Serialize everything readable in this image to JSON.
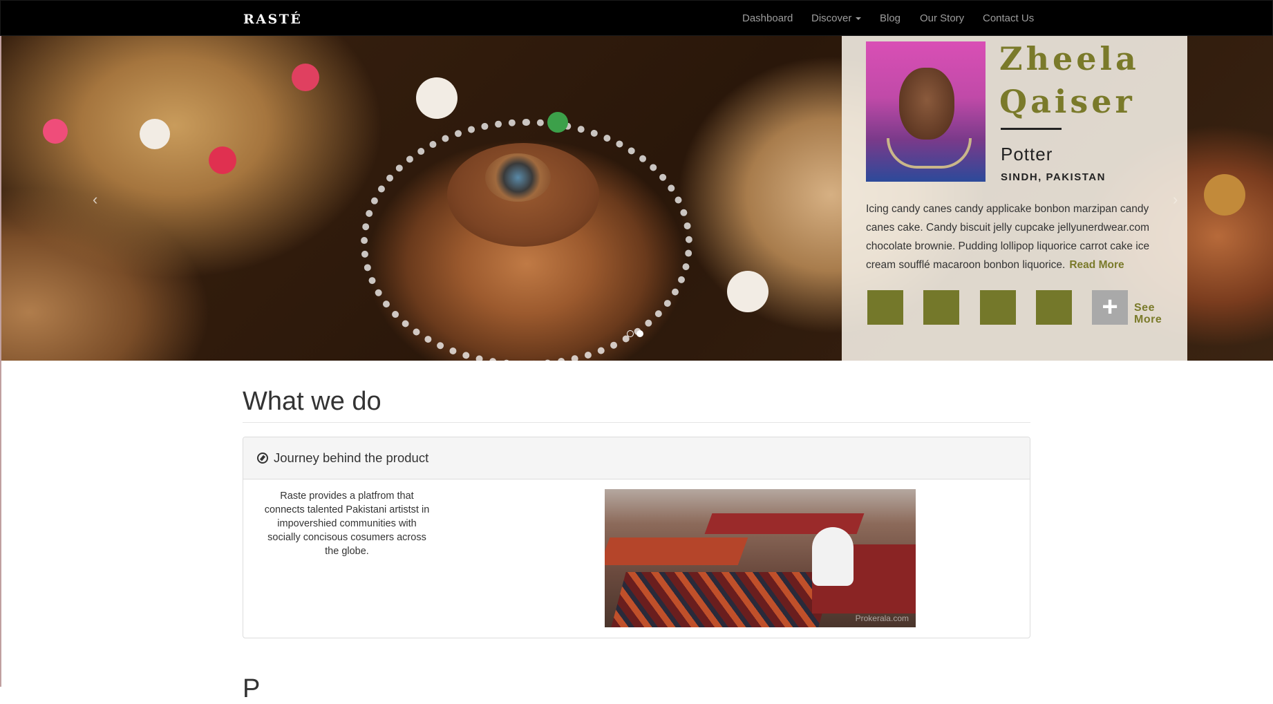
{
  "navbar": {
    "brand": "RASTÉ",
    "items": [
      {
        "label": "Dashboard"
      },
      {
        "label": "Discover"
      },
      {
        "label": "Blog"
      },
      {
        "label": "Our Story"
      },
      {
        "label": "Contact Us"
      }
    ]
  },
  "carousel": {
    "prev_glyph": "‹",
    "next_glyph": "›",
    "slides_count": 2,
    "active_slide": 2
  },
  "artisan": {
    "first_name": "Zheela",
    "last_name": "Qaiser",
    "role": "Potter",
    "location": "SINDH, PAKISTAN",
    "bio": "Icing candy canes candy applicake bonbon marzipan candy canes cake. Candy biscuit jelly cupcake jellyunerdwear.com chocolate brownie. Pudding lollipop liquorice carrot cake ice cream soufflé macaroon bonbon liquorice.",
    "read_more": "Read More",
    "plus_glyph": "+",
    "see_more": "See More",
    "accent_color": "#74782a"
  },
  "what_we_do": {
    "title": "What we do",
    "panel_title": "Journey behind the product",
    "panel_icon": "compass-icon",
    "description": "Raste provides a platfrom that connects talented Pakistani artistst in impovershied communities with socially concisous cosumers across the globe.",
    "photo_watermark": "Prokerala.com"
  },
  "next_section": {
    "title_fragment": "P"
  }
}
